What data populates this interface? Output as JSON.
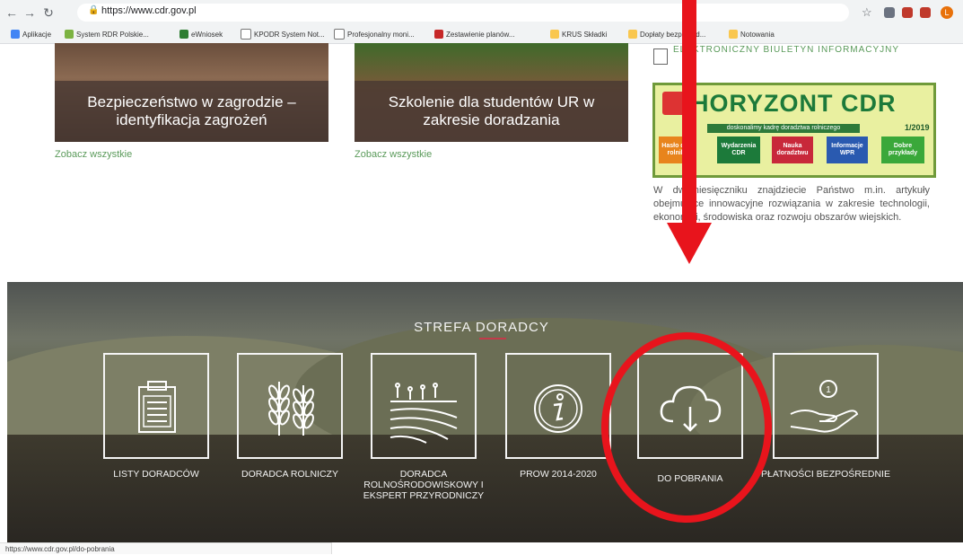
{
  "browser": {
    "url": "https://www.cdr.gov.pl",
    "bookmarks": [
      {
        "label": "Aplikacje",
        "color": "#4285f4"
      },
      {
        "label": "System RDR Polskie...",
        "color": "#7cb342"
      },
      {
        "label": "eWniosek",
        "color": "#2e7d32"
      },
      {
        "label": "KPODR System Not...",
        "color": "#ffffff"
      },
      {
        "label": "Profesjonalny moni...",
        "color": "#ffffff"
      },
      {
        "label": "Zestawienie planów...",
        "color": "#c62828"
      },
      {
        "label": "KRUS Składki",
        "color": "#f9c74f"
      },
      {
        "label": "Dopłaty bezpośred...",
        "color": "#f9c74f"
      },
      {
        "label": "Notowania",
        "color": "#f9c74f"
      }
    ],
    "status_url": "https://www.cdr.gov.pl/do-pobrania"
  },
  "news": [
    {
      "title": "Bezpieczeństwo w zagrodzie – identyfikacja zagrożeń",
      "link": "Zobacz wszystkie"
    },
    {
      "title": "Szkolenie dla studentów UR w zakresie doradzania",
      "link": "Zobacz wszystkie"
    }
  ],
  "sidebar": {
    "ebi_title": "ELEKTRONICZNY BIULETYN INFORMACYJNY",
    "horyzont": {
      "title": "HORYZONT CDR",
      "tagline": "doskonalimy kadrę doradztwa rolniczego",
      "issue": "1/2019",
      "buttons": [
        {
          "label": "Hasło dnia rolnika",
          "color": "#e8841c"
        },
        {
          "label": "Wydarzenia CDR",
          "color": "#1c7a3a"
        },
        {
          "label": "Nauka doradztwu",
          "color": "#c8283a"
        },
        {
          "label": "Informacje WPR",
          "color": "#2a5ab0"
        },
        {
          "label": "Dobre przykłady",
          "color": "#3aa83a"
        }
      ]
    },
    "description": "W dwumiesięczniku znajdziecie Państwo m.in. artykuły obejmujące innowacyjne rozwiązania w zakresie technologii, ekonomiki, środowiska oraz rozwoju obszarów wiejskich."
  },
  "strefa": {
    "title": "STREFA DORADCY",
    "items": [
      {
        "label": "LISTY DORADCÓW",
        "icon": "clipboard-icon"
      },
      {
        "label": "DORADCA ROLNICZY",
        "icon": "wheat-icon"
      },
      {
        "label": "DORADCA ROLNOŚRODOWISKOWY I EKSPERT PRZYRODNICZY",
        "icon": "field-icon"
      },
      {
        "label": "PROW 2014-2020",
        "icon": "info-icon"
      },
      {
        "label": "DO POBRANIA",
        "icon": "cloud-download-icon"
      },
      {
        "label": "PŁATNOŚCI BEZPOŚREDNIE",
        "icon": "hand-coin-icon"
      }
    ]
  },
  "annotation": {
    "color": "#e8141c"
  }
}
